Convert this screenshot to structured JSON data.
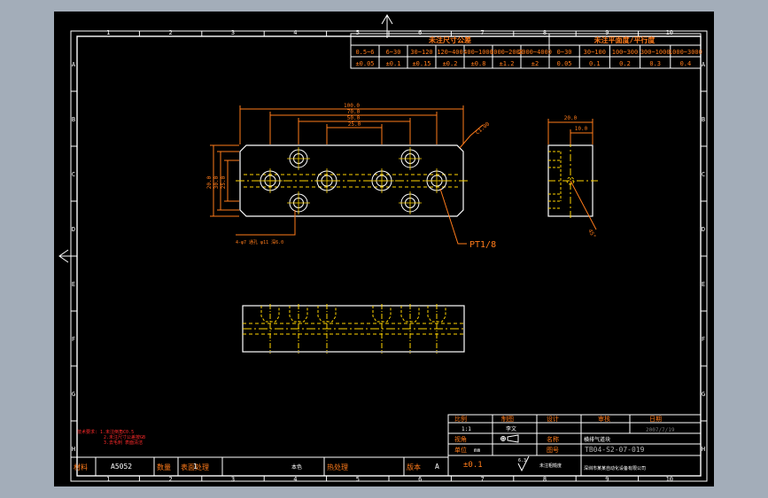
{
  "zone_columns": [
    "1",
    "2",
    "3",
    "4",
    "5",
    "6",
    "7",
    "8",
    "9",
    "10"
  ],
  "zone_rows": [
    "A",
    "B",
    "C",
    "D",
    "E",
    "F",
    "G",
    "H"
  ],
  "tolerance_table": {
    "left_title": "未注尺寸公差",
    "right_title": "未注平面度/平行度",
    "left_ranges": [
      "0.5~6",
      "6~30",
      "30~120",
      "120~400",
      "400~1000",
      "1000~2000",
      "2000~4000"
    ],
    "left_values": [
      "±0.05",
      "±0.1",
      "±0.15",
      "±0.2",
      "±0.8",
      "±1.2",
      "±2"
    ],
    "right_ranges": [
      "0~30",
      "30~100",
      "100~300",
      "300~1000",
      "1000~3000"
    ],
    "right_values": [
      "0.05",
      "0.1",
      "0.2",
      "0.3",
      "0.4"
    ]
  },
  "dimensions": {
    "overall": "100.0",
    "span_a": "70.0",
    "span_b": "50.0",
    "span_c": "25.0",
    "height_a": "20.0",
    "height_b": "30.0",
    "height_c": "25.0",
    "chamfer": "C1.00",
    "side_width": "20.0",
    "side_half": "10.0",
    "angle": "45°",
    "port_label": "PT1/8",
    "hole_note": "4-φ7 通孔 φ11 深6.0"
  },
  "notes": {
    "line1": "技术要求: 1.未注倒角C0.5",
    "line2": "2.未注尺寸公差按GB",
    "line3": "3.去毛刺 表面清洁"
  },
  "title_block": {
    "header_scale": "比例",
    "header_drawing": "制图",
    "header_design": "设计",
    "header_review": "审核",
    "header_date": "日期",
    "scale_value": "1:1",
    "drawn_by": "李文",
    "date_value": "2007/7/19",
    "view_label": "视角",
    "unit_label": "单位",
    "unit_value": "mm",
    "name_label": "名称",
    "name_value": "横排气道块",
    "drawing_no_label": "图号",
    "drawing_no_value": "TB04-S2-07-019",
    "company_value": "深圳市某某自动化设备有限公司",
    "roughness_label": "未注粗糙度",
    "roughness_value": "6.3"
  },
  "bottom_strip": {
    "material_label": "材料",
    "material_value": "A5052",
    "qty_label": "数量",
    "qty_value": "1",
    "surface_label": "表面处理",
    "surface_value": "本色",
    "heat_label": "热处理",
    "version_label": "版本",
    "version_value": "A",
    "tolerance_value": "±0.1"
  }
}
